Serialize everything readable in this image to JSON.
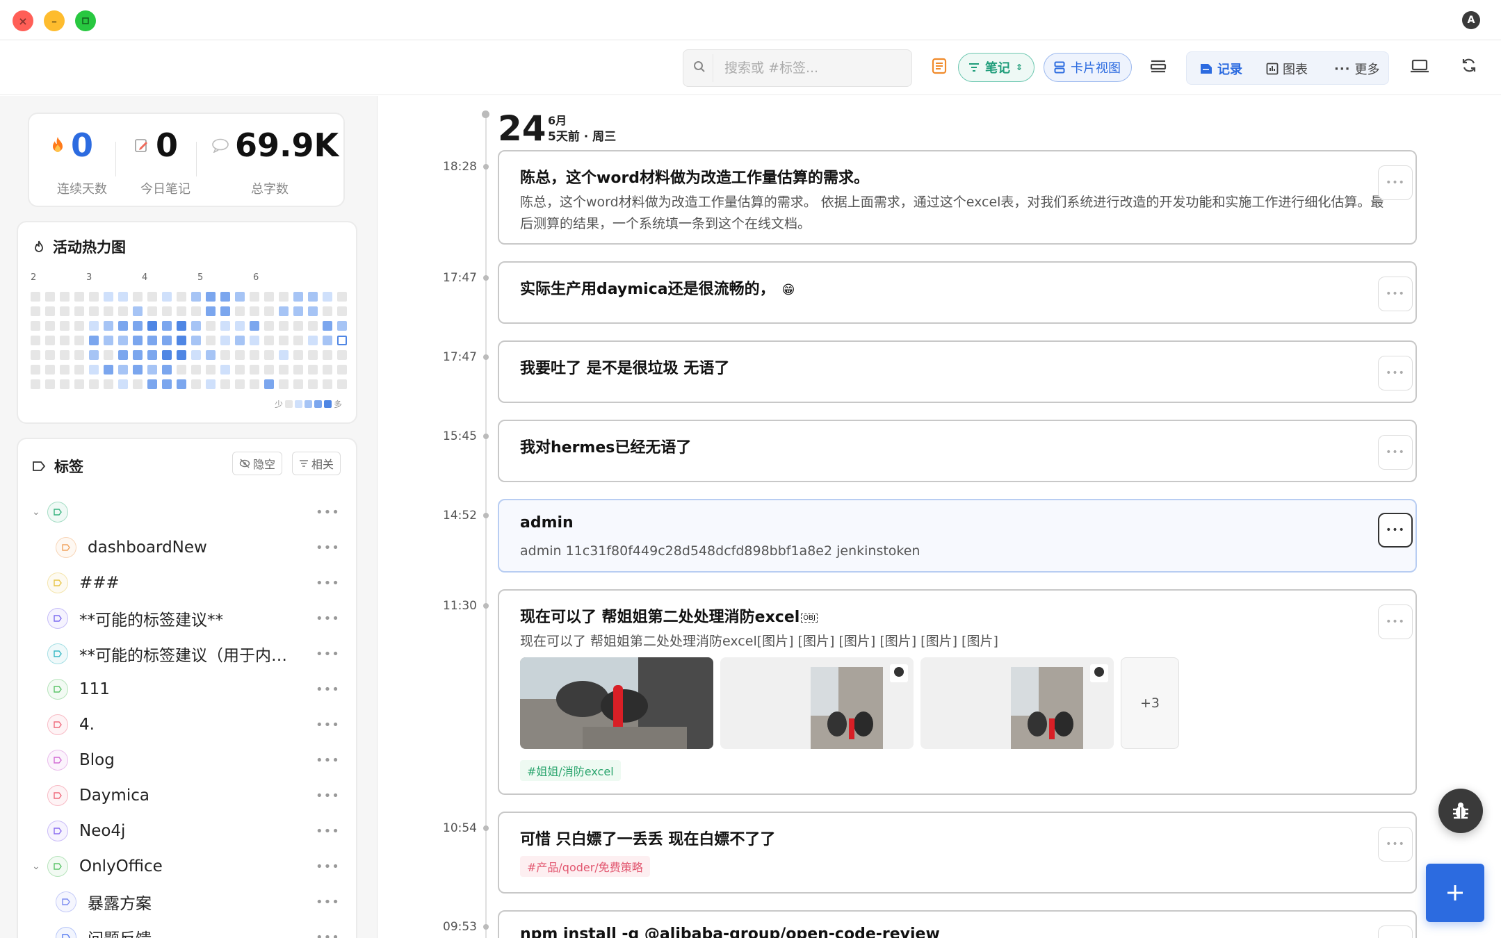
{
  "window": {
    "app_badge": "A"
  },
  "toolbar": {
    "search_placeholder": "搜索或 #标签...",
    "filter_label": "笔记",
    "card_view_label": "卡片视图",
    "views": [
      {
        "label": "记录",
        "active": true
      },
      {
        "label": "图表",
        "active": false
      },
      {
        "label": "更多",
        "active": false
      }
    ]
  },
  "stats": [
    {
      "value": "0",
      "label": "连续天数",
      "icon": "fire-icon"
    },
    {
      "value": "0",
      "label": "今日笔记",
      "icon": "note-pencil-icon"
    },
    {
      "value": "69.9K",
      "label": "总字数",
      "icon": "chat-bubble-icon"
    }
  ],
  "heatmap": {
    "title": "活动热力图",
    "months": [
      "2",
      "3",
      "4",
      "5",
      "6"
    ],
    "legend_less": "少",
    "legend_more": "多",
    "colors": [
      "#e6e6e6",
      "#cfe0fb",
      "#a6c4f5",
      "#7ba6ee",
      "#4f86e4"
    ]
  },
  "tags": {
    "title": "标签",
    "btn_hide_empty": "隐空",
    "btn_related": "相关",
    "items": [
      {
        "name": "",
        "level": 0,
        "expanded": true,
        "color": "#36b37e"
      },
      {
        "name": "dashboardNew",
        "level": 1,
        "color": "#f0a35e"
      },
      {
        "name": "###",
        "level": 0,
        "color": "#e8c547"
      },
      {
        "name": "**可能的标签建议**",
        "level": 0,
        "color": "#7c6cf0"
      },
      {
        "name": "**可能的标签建议（用于内…",
        "level": 0,
        "color": "#36b8c4"
      },
      {
        "name": "111",
        "level": 0,
        "color": "#5cc46a"
      },
      {
        "name": "4.",
        "level": 0,
        "color": "#ef6a7c"
      },
      {
        "name": "Blog",
        "level": 0,
        "color": "#d26bd4"
      },
      {
        "name": "Daymica",
        "level": 0,
        "color": "#ef6a7c"
      },
      {
        "name": "Neo4j",
        "level": 0,
        "color": "#8a6cf0"
      },
      {
        "name": "OnlyOffice",
        "level": 0,
        "expanded": true,
        "color": "#5cc46a"
      },
      {
        "name": "暴露方案",
        "level": 1,
        "color": "#7c8cf0"
      },
      {
        "name": "问题反馈",
        "level": 1,
        "color": "#5a7ef0"
      }
    ]
  },
  "timeline": {
    "day": "24",
    "month": "6月",
    "relative": "5天前 · 周三",
    "notes": [
      {
        "time": "18:28",
        "title": "陈总，这个word材料做为改造工作量估算的需求。",
        "body": "陈总，这个word材料做为改造工作量估算的需求。 依据上面需求，通过这个excel表，对我们系统进行改造的开发功能和实施工作进行细化估算。最后测算的结果，一个系统填一条到这个在线文档。"
      },
      {
        "time": "17:47",
        "title": "实际生产用daymica还是很流畅的，",
        "emoji": "😁"
      },
      {
        "time": "17:47",
        "title": "我要吐了 是不是很垃圾 无语了"
      },
      {
        "time": "15:45",
        "title": "我对hermes已经无语了"
      },
      {
        "time": "14:52",
        "title": "admin",
        "body": "admin 11c31f80f449c28d548dcfd898bbf1a8e2 jenkinstoken",
        "highlighted": true
      },
      {
        "time": "11:30",
        "title": "现在可以了 帮姐姐第二处处理消防excel",
        "title_glyph": "OBJ",
        "body": "现在可以了 帮姐姐第二处处理消防excel[图片] [图片] [图片] [图片] [图片] [图片]",
        "more_images": "+3",
        "tag": "#姐姐/消防excel"
      },
      {
        "time": "10:54",
        "title": "可惜 只白嫖了一丢丢 现在白嫖不了了",
        "tag": "#产品/qoder/免费策略"
      },
      {
        "time": "09:53",
        "title": "npm install -g @alibaba-group/open-code-review"
      }
    ]
  },
  "colors": {
    "accent_blue": "#2c6be0",
    "accent_green": "#1f9d7a",
    "fire": "#ff7a1a"
  }
}
